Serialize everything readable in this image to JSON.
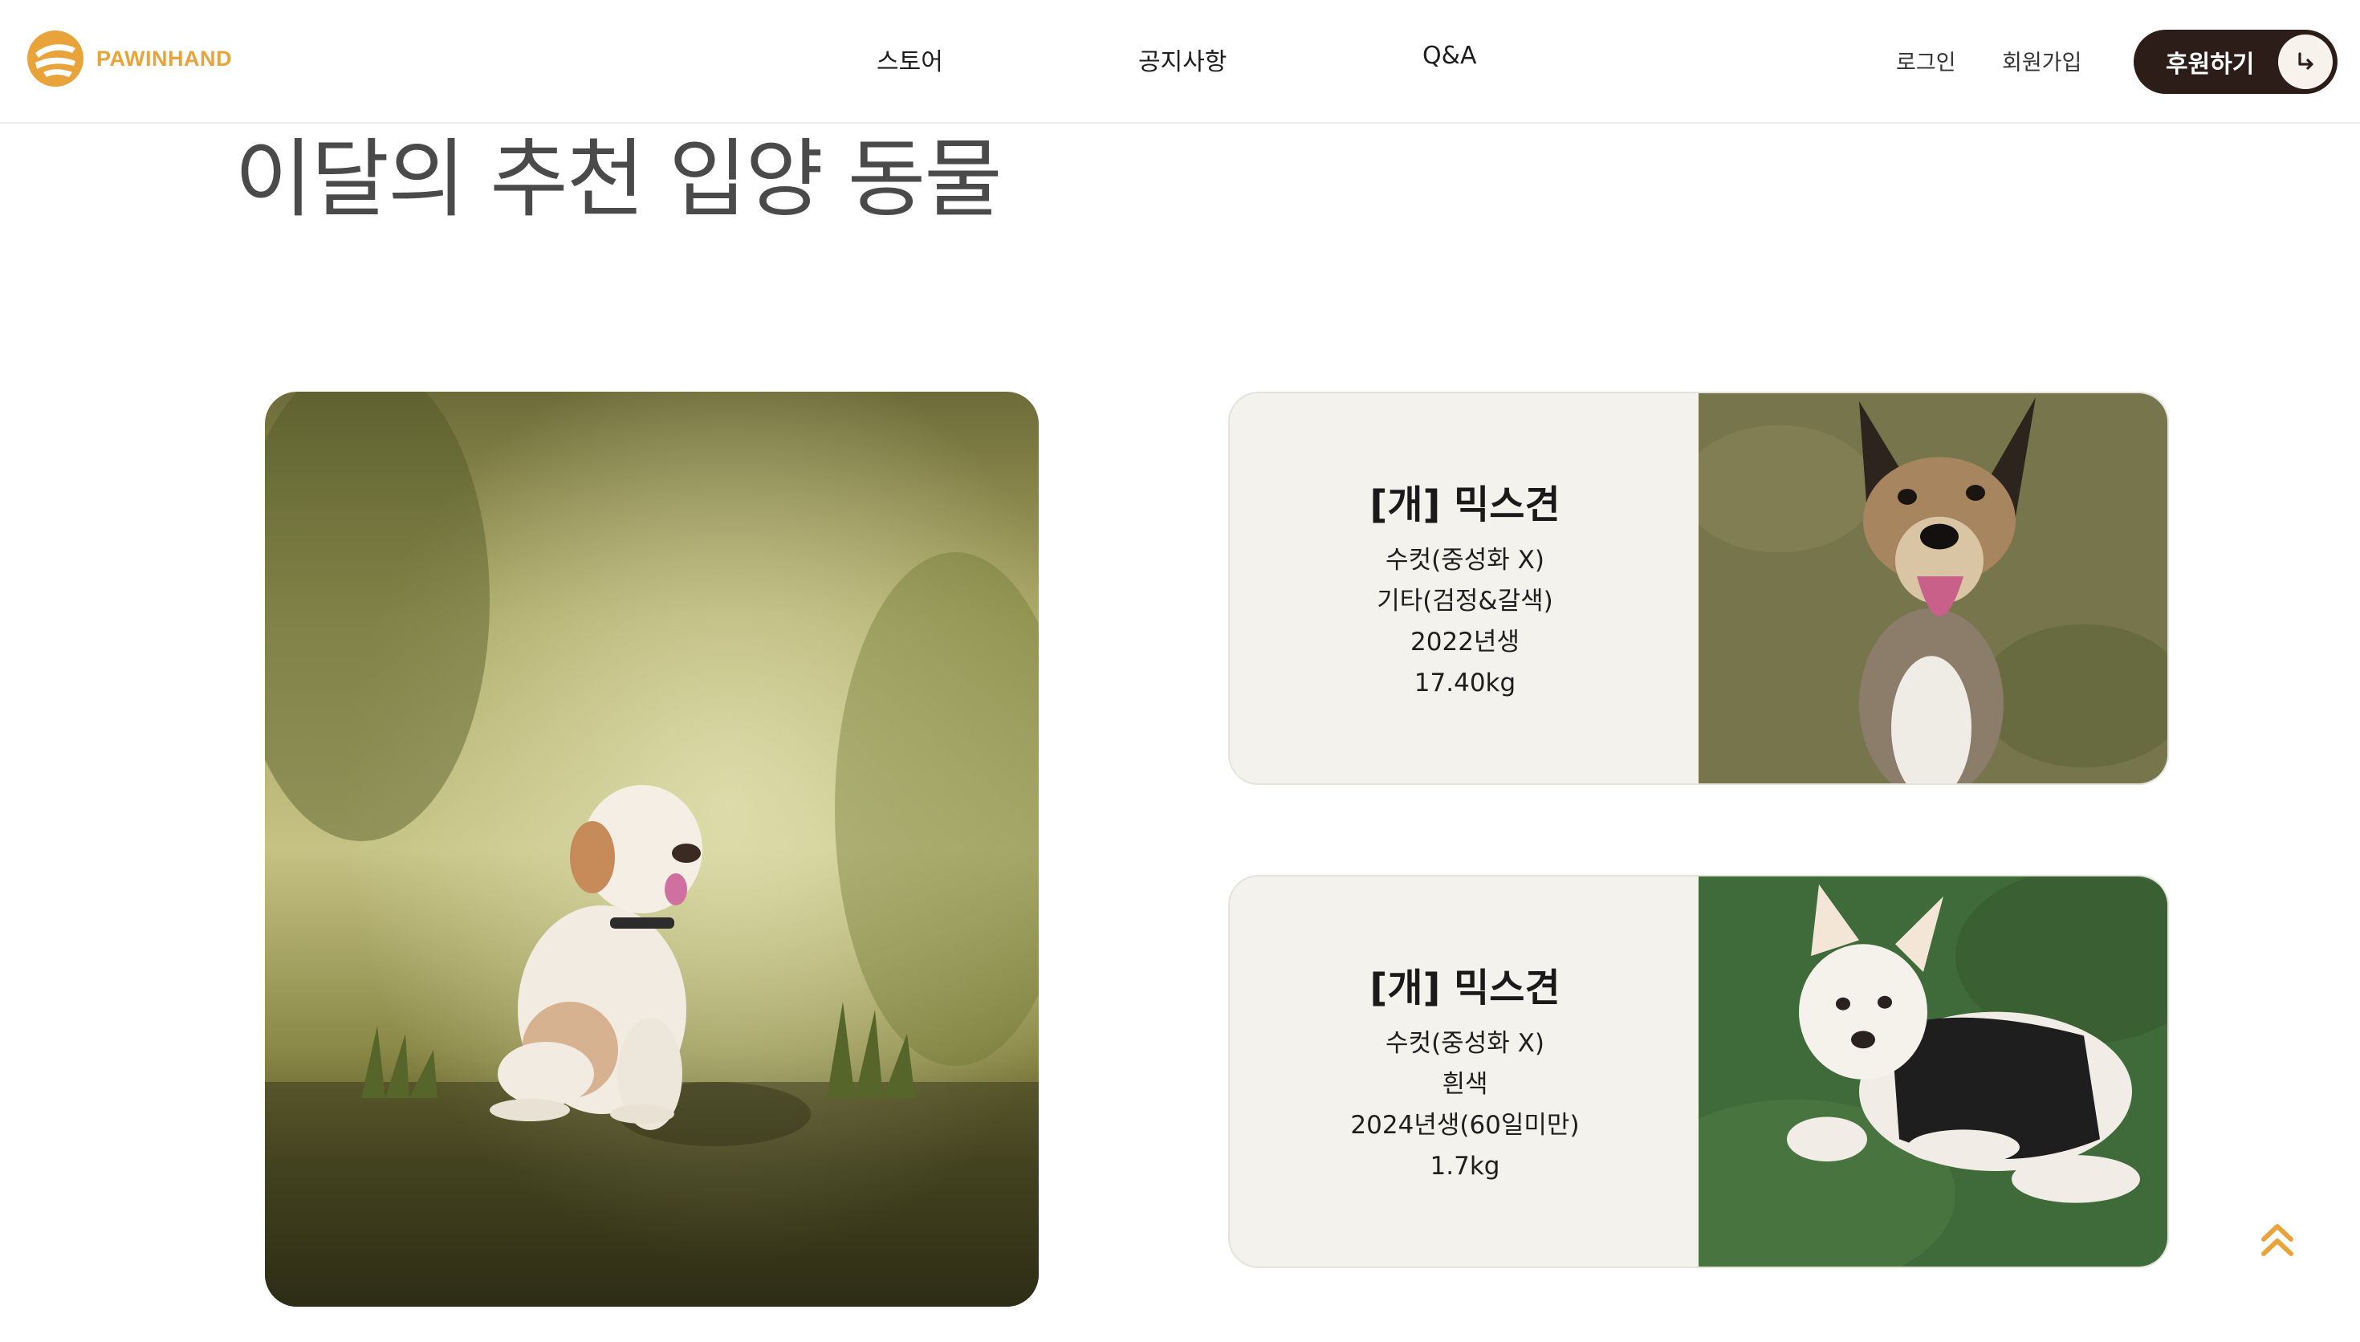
{
  "header": {
    "logo_text": "PAWINHAND",
    "logo_icon": "hand-paw-logo-icon",
    "nav": [
      {
        "label": "스토어"
      },
      {
        "label": "공지사항"
      },
      {
        "label": "Q&A"
      }
    ],
    "login_label": "로그인",
    "signup_label": "회원가입",
    "donate_label": "후원하기",
    "donate_icon": "arrow-return-icon",
    "brand_color": "#e8a43a",
    "donate_color": "#2d1d19"
  },
  "main": {
    "title": "이달의 추천 입양 동물",
    "featured_image": "poodle-sitting-in-forest-photo",
    "cards": [
      {
        "name": "[개] 믹스견",
        "lines": [
          "수컷(중성화 X)",
          "기타(검정&갈색)",
          "2022년생",
          "17.40kg"
        ],
        "image": "shepherd-mix-dog-on-grass-photo"
      },
      {
        "name": "[개] 믹스견",
        "lines": [
          "수컷(중성화 X)",
          "흰색",
          "2024년생(60일미만)",
          "1.7kg"
        ],
        "image": "white-puppy-in-black-sweater-photo"
      }
    ]
  },
  "scroll_top_icon": "double-chevron-up-icon"
}
